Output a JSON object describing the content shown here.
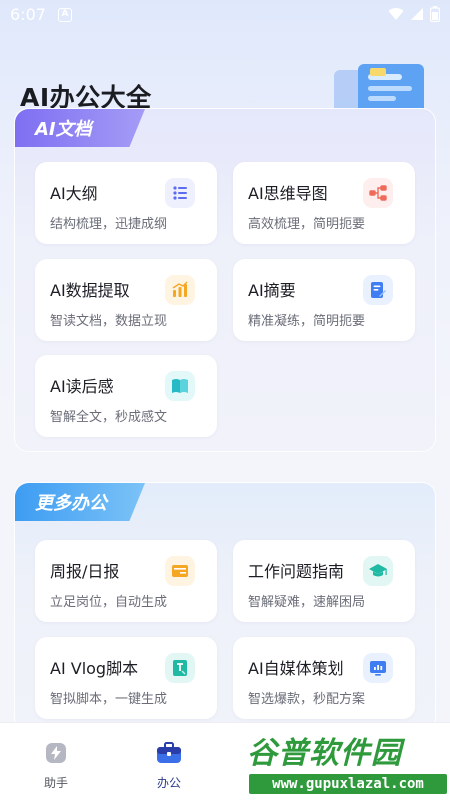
{
  "status_bar": {
    "time": "6:07",
    "notif_letter": "A"
  },
  "header": {
    "title": "AI办公大全"
  },
  "sections": [
    {
      "tab_label": "AI文档",
      "cards": [
        {
          "title": "AI大纲",
          "subtitle": "结构梳理，迅捷成纲",
          "icon": "list-icon",
          "color": "#5b6cf0",
          "bg": "#eef0fe"
        },
        {
          "title": "AI思维导图",
          "subtitle": "高效梳理，简明扼要",
          "icon": "mindmap-icon",
          "color": "#f06a5a",
          "bg": "#feeeee"
        },
        {
          "title": "AI数据提取",
          "subtitle": "智读文档，数据立现",
          "icon": "bar-chart-icon",
          "color": "#f5a623",
          "bg": "#fff4e2"
        },
        {
          "title": "AI摘要",
          "subtitle": "精准凝练，简明扼要",
          "icon": "doc-edit-icon",
          "color": "#3f7df2",
          "bg": "#e9f1fe"
        },
        {
          "title": "AI读后感",
          "subtitle": "智解全文，秒成感文",
          "icon": "book-icon",
          "color": "#26b9c6",
          "bg": "#e3f8f9"
        }
      ]
    },
    {
      "tab_label": "更多办公",
      "cards": [
        {
          "title": "周报/日报",
          "subtitle": "立足岗位，自动生成",
          "icon": "report-icon",
          "color": "#f5a623",
          "bg": "#fff4e2"
        },
        {
          "title": "工作问题指南",
          "subtitle": "智解疑难，速解困局",
          "icon": "graduation-cap-icon",
          "color": "#1fb9a4",
          "bg": "#e2f7f3"
        },
        {
          "title": "AI Vlog脚本",
          "subtitle": "智拟脚本，一键生成",
          "icon": "script-icon",
          "color": "#1fb9a4",
          "bg": "#e2f7f3"
        },
        {
          "title": "AI自媒体策划",
          "subtitle": "智选爆款，秒配方案",
          "icon": "presentation-icon",
          "color": "#3f7df2",
          "bg": "#e9f1fe"
        }
      ]
    }
  ],
  "bottom_nav": [
    {
      "label": "助手",
      "icon": "lightning-icon"
    },
    {
      "label": "办公",
      "icon": "briefcase-icon",
      "active": true
    }
  ],
  "watermark": {
    "top": "谷普软件园",
    "bottom": "www.gupuxlazal.com"
  }
}
